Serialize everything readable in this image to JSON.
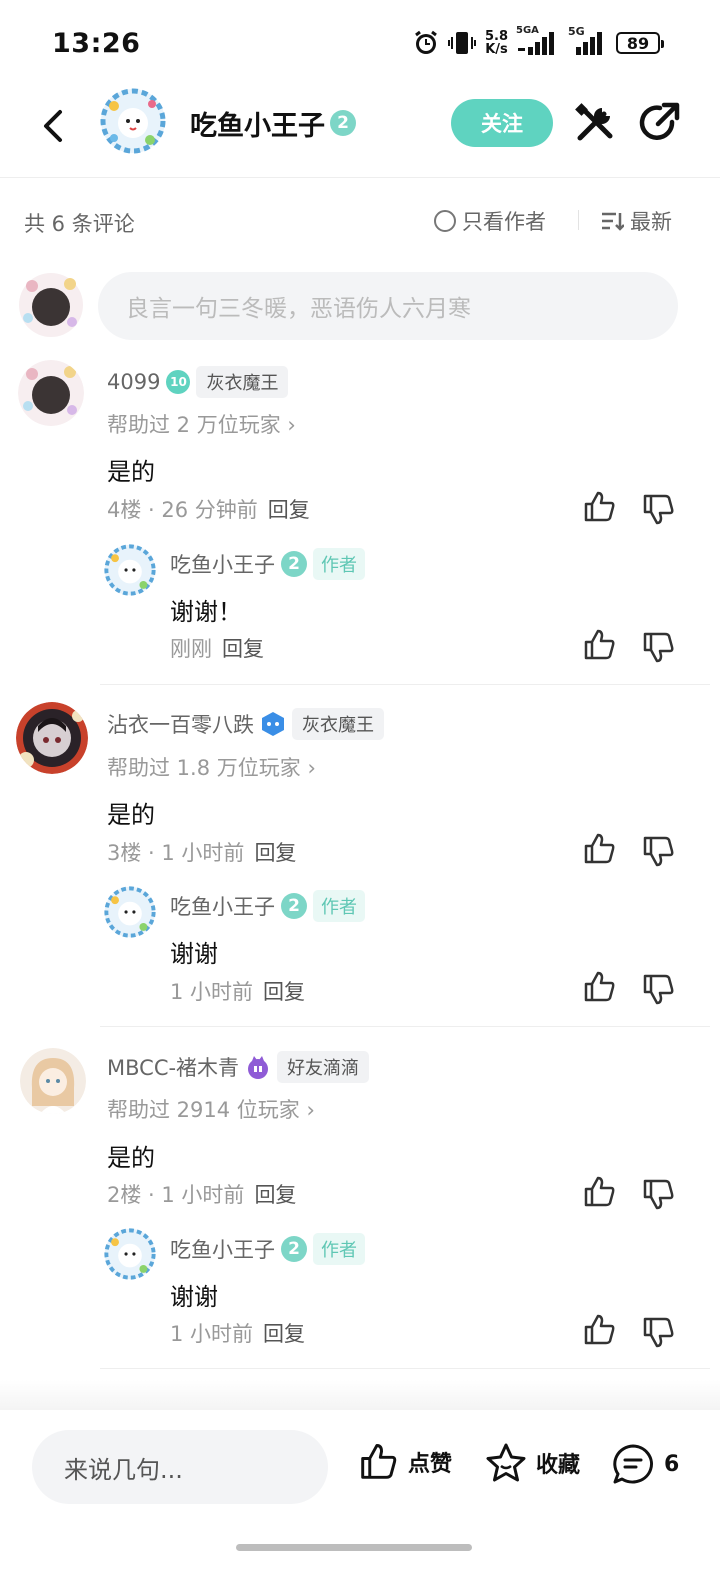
{
  "status_bar": {
    "time": "13:26",
    "net_speed_top": "5.8",
    "net_speed_bottom": "K/s",
    "sig1": "5GA",
    "sig2": "5G",
    "battery": "89",
    "icons": [
      "alarm-icon",
      "vibrate-icon",
      "signal-icon",
      "signal-icon"
    ]
  },
  "header": {
    "name": "吃鱼小王子",
    "level": "2",
    "follow_label": "关注",
    "icons": [
      "back-icon",
      "tools-icon",
      "share-icon"
    ]
  },
  "comments_bar": {
    "total": "共 6 条评论",
    "only_author": "只看作者",
    "sort": "最新"
  },
  "input": {
    "placeholder": "良言一句三冬暖，恶语伤人六月寒"
  },
  "comments": [
    {
      "name": "4099",
      "badge": "10",
      "tag": "灰衣魔王",
      "helped": "帮助过 2 万位玩家",
      "text": "是的",
      "meta": "4楼 · 26 分钟前",
      "reply": "回复",
      "replies": [
        {
          "name": "吃鱼小王子",
          "level": "2",
          "author_tag": "作者",
          "text": "谢谢！",
          "meta": "刚刚",
          "reply": "回复"
        }
      ]
    },
    {
      "name": "沾衣一百零八跌",
      "badge": "",
      "tag": "灰衣魔王",
      "helped": "帮助过 1.8 万位玩家",
      "text": "是的",
      "meta": "3楼 · 1 小时前",
      "reply": "回复",
      "replies": [
        {
          "name": "吃鱼小王子",
          "level": "2",
          "author_tag": "作者",
          "text": "谢谢",
          "meta": "1 小时前",
          "reply": "回复"
        }
      ]
    },
    {
      "name": "MBCC-褚木青",
      "badge": "",
      "tag": "好友滴滴",
      "helped": "帮助过 2914 位玩家",
      "text": "是的",
      "meta": "2楼 · 1 小时前",
      "reply": "回复",
      "replies": [
        {
          "name": "吃鱼小王子",
          "level": "2",
          "author_tag": "作者",
          "text": "谢谢",
          "meta": "1 小时前",
          "reply": "回复"
        }
      ]
    }
  ],
  "bottom_bar": {
    "say_placeholder": "来说几句...",
    "like_label": "点赞",
    "fav_label": "收藏",
    "comment_count": "6"
  },
  "colors": {
    "accent": "#5fd3c0",
    "level_badge": "#7dd6c7"
  }
}
